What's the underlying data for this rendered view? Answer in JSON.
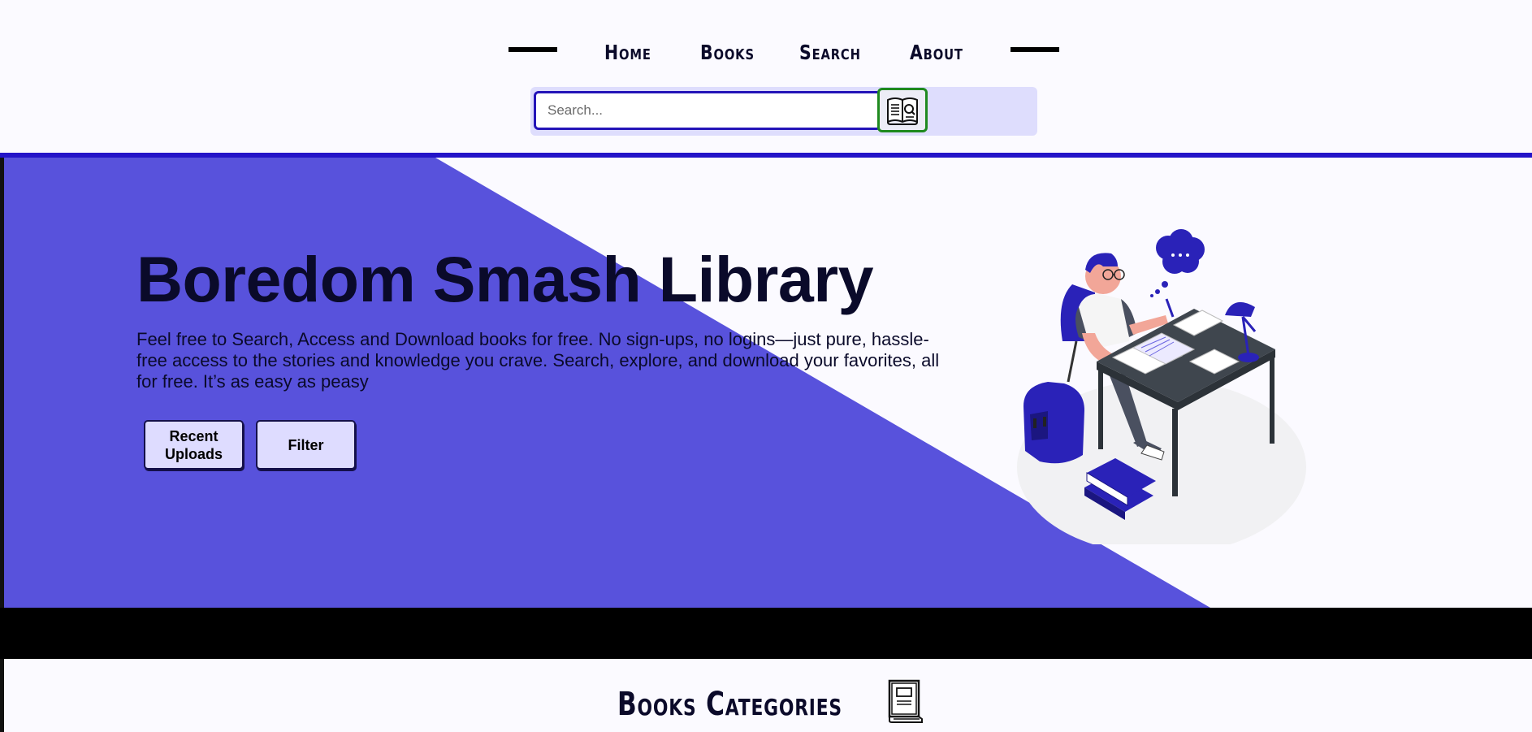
{
  "nav": {
    "links": [
      {
        "label": "Home"
      },
      {
        "label": "Books"
      },
      {
        "label": "Search"
      },
      {
        "label": "About"
      }
    ]
  },
  "search": {
    "placeholder": "Search...",
    "value": "",
    "button_icon": "open-book-search-icon"
  },
  "hero": {
    "title": "Boredom Smash Library",
    "description": "Feel free to Search, Access and Download books for free. No sign-ups, no logins—just pure, hassle-free access to the stories and knowledge you crave. Search, explore, and download your favorites, all for free. It’s as easy as peasy",
    "buttons": {
      "recent_uploads": "Recent Uploads",
      "filter": "Filter"
    },
    "illustration": "person-studying-at-desk-illustration"
  },
  "categories": {
    "title": "Books Categories",
    "icon": "book-icon"
  },
  "colors": {
    "accent": "#2414c8",
    "hero_purple": "#5852dc",
    "panel_lavender": "#deddfd",
    "search_border": "#2414b8",
    "search_button_border": "#1f8a1f",
    "band": "#000000",
    "background": "#fbfaff"
  }
}
